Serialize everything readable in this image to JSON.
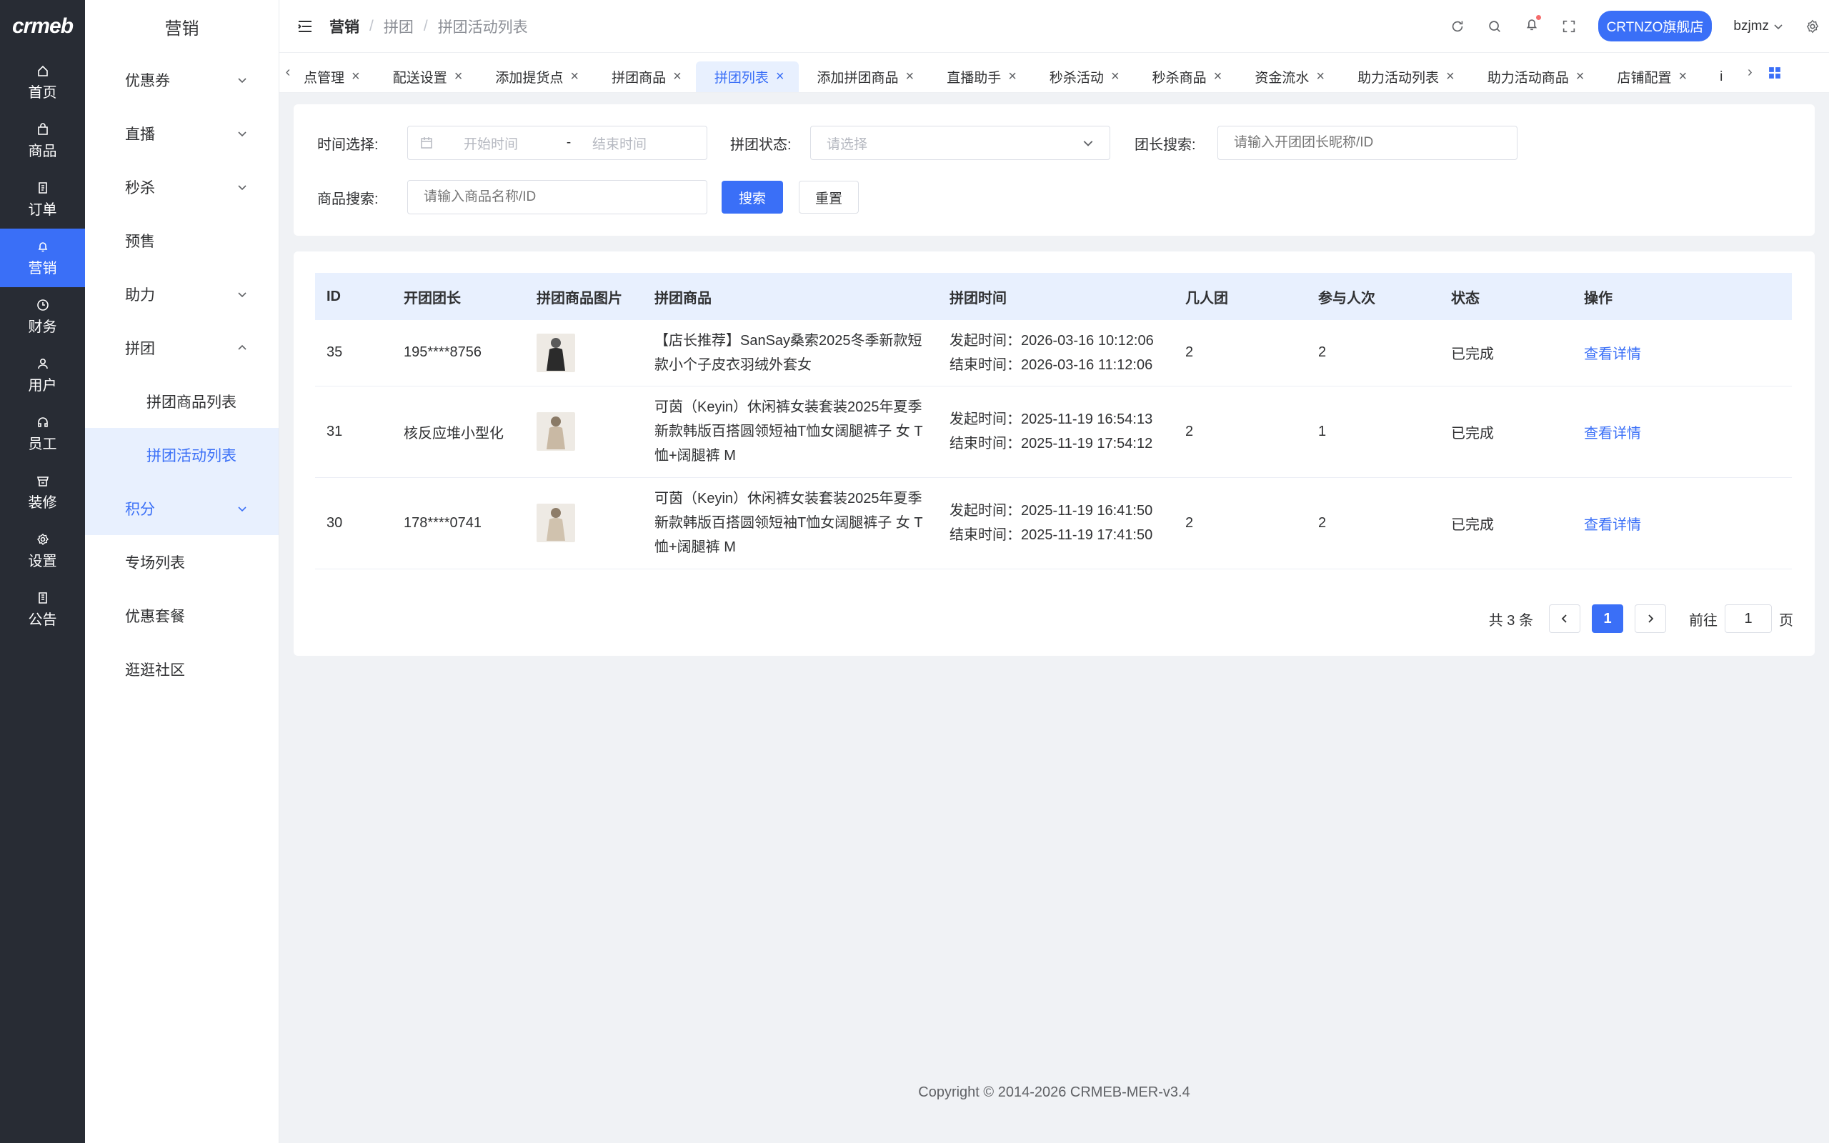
{
  "rail": {
    "logo": "crmeb",
    "items": [
      {
        "label": "首页",
        "icon": "home-icon"
      },
      {
        "label": "商品",
        "icon": "bag-icon"
      },
      {
        "label": "订单",
        "icon": "order-icon"
      },
      {
        "label": "营销",
        "icon": "bell-icon",
        "active": true
      },
      {
        "label": "财务",
        "icon": "clock-icon"
      },
      {
        "label": "用户",
        "icon": "user-icon"
      },
      {
        "label": "员工",
        "icon": "headset-icon"
      },
      {
        "label": "装修",
        "icon": "store-icon"
      },
      {
        "label": "设置",
        "icon": "gear-icon"
      },
      {
        "label": "公告",
        "icon": "notice-icon"
      }
    ]
  },
  "submenu": {
    "title": "营销",
    "items": {
      "coupon": "优惠券",
      "live": "直播",
      "seckill": "秒杀",
      "presale": "预售",
      "assist": "助力",
      "group": "拼团",
      "group_products": "拼团商品列表",
      "group_activities": "拼团活动列表",
      "points": "积分",
      "special": "专场列表",
      "package": "优惠套餐",
      "community": "逛逛社区"
    }
  },
  "header": {
    "breadcrumb": [
      "营销",
      "拼团",
      "拼团活动列表"
    ],
    "store": "CRTNZO旗舰店",
    "user": "bzjmz"
  },
  "tabs": [
    "点管理",
    "配送设置",
    "添加提货点",
    "拼团商品",
    "拼团列表",
    "添加拼团商品",
    "直播助手",
    "秒杀活动",
    "秒杀商品",
    "资金流水",
    "助力活动列表",
    "助力活动商品",
    "店铺配置",
    "i"
  ],
  "active_tab": 4,
  "filters": {
    "time_label": "时间选择:",
    "start_placeholder": "开始时间",
    "range_sep": "-",
    "end_placeholder": "结束时间",
    "status_label": "拼团状态:",
    "status_placeholder": "请选择",
    "leader_label": "团长搜索:",
    "leader_placeholder": "请输入开团团长昵称/ID",
    "product_label": "商品搜索:",
    "product_placeholder": "请输入商品名称/ID",
    "search_btn": "搜索",
    "reset_btn": "重置"
  },
  "table": {
    "columns": [
      "ID",
      "开团团长",
      "拼团商品图片",
      "拼团商品",
      "拼团时间",
      "几人团",
      "参与人次",
      "状态",
      "操作"
    ],
    "rows": [
      {
        "id": "35",
        "leader": "195****8756",
        "product_lines": [
          "【店长推荐】SanSay桑索2025冬季新款短",
          "款小个子皮衣羽绒外套女"
        ],
        "start": "发起时间：2026-03-16 10:12:06",
        "end": "结束时间：2026-03-16 11:12:06",
        "size": "2",
        "joined": "2",
        "status": "已完成",
        "action": "查看详情"
      },
      {
        "id": "31",
        "leader": "核反应堆小型化",
        "product_lines": [
          "可茵（Keyin）休闲裤女装套装2025年夏季",
          "新款韩版百搭圆领短袖T恤女阔腿裤子 女 T",
          "恤+阔腿裤 M"
        ],
        "start": "发起时间：2025-11-19 16:54:13",
        "end": "结束时间：2025-11-19 17:54:12",
        "size": "2",
        "joined": "1",
        "status": "已完成",
        "action": "查看详情"
      },
      {
        "id": "30",
        "leader": "178****0741",
        "product_lines": [
          "可茵（Keyin）休闲裤女装套装2025年夏季",
          "新款韩版百搭圆领短袖T恤女阔腿裤子 女 T",
          "恤+阔腿裤 M"
        ],
        "start": "发起时间：2025-11-19 16:41:50",
        "end": "结束时间：2025-11-19 17:41:50",
        "size": "2",
        "joined": "2",
        "status": "已完成",
        "action": "查看详情"
      }
    ]
  },
  "pagination": {
    "total": "共 3 条",
    "current": "1",
    "goto_label": "前往",
    "goto_value": "1",
    "page_suffix": "页"
  },
  "footer": "Copyright © 2014-2026 CRMEB-MER-v3.4",
  "colors": {
    "accent": "#3a6ff7",
    "rail": "#282c34"
  }
}
